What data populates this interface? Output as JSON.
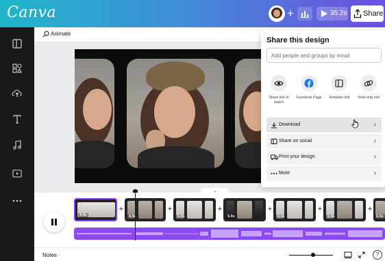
{
  "app": {
    "logo": "Canva"
  },
  "header": {
    "add_label": "+",
    "play_duration": "35.2s",
    "share_label": "Share"
  },
  "toolbar": {
    "animate_label": "Animate"
  },
  "share_panel": {
    "title": "Share this design",
    "email_placeholder": "Add people and groups by email",
    "options": [
      {
        "label": "Share link to watch",
        "icon": "eye-icon"
      },
      {
        "label": "Facebook Page",
        "icon": "facebook-icon"
      },
      {
        "label": "Template link",
        "icon": "template-icon"
      },
      {
        "label": "View-only link",
        "icon": "link-icon"
      }
    ],
    "rows": [
      {
        "label": "Download",
        "icon": "download-icon"
      },
      {
        "label": "Share on social",
        "icon": "share-social-icon"
      },
      {
        "label": "Print your design",
        "icon": "truck-icon"
      },
      {
        "label": "More",
        "icon": "more-icon"
      }
    ]
  },
  "timeline": {
    "clips": [
      {
        "duration": "4.9s"
      },
      {
        "duration": "4.9s"
      },
      {
        "duration": "5.0s"
      },
      {
        "duration": "5.0s"
      },
      {
        "duration": "5.0s"
      },
      {
        "duration": "5.0s"
      },
      {
        "duration": "5.0s"
      }
    ]
  },
  "footer": {
    "notes_label": "Notes",
    "help_label": "?"
  },
  "colors": {
    "accent": "#8b3dff",
    "audio": "#8d47f5",
    "facebook": "#1877f2"
  }
}
